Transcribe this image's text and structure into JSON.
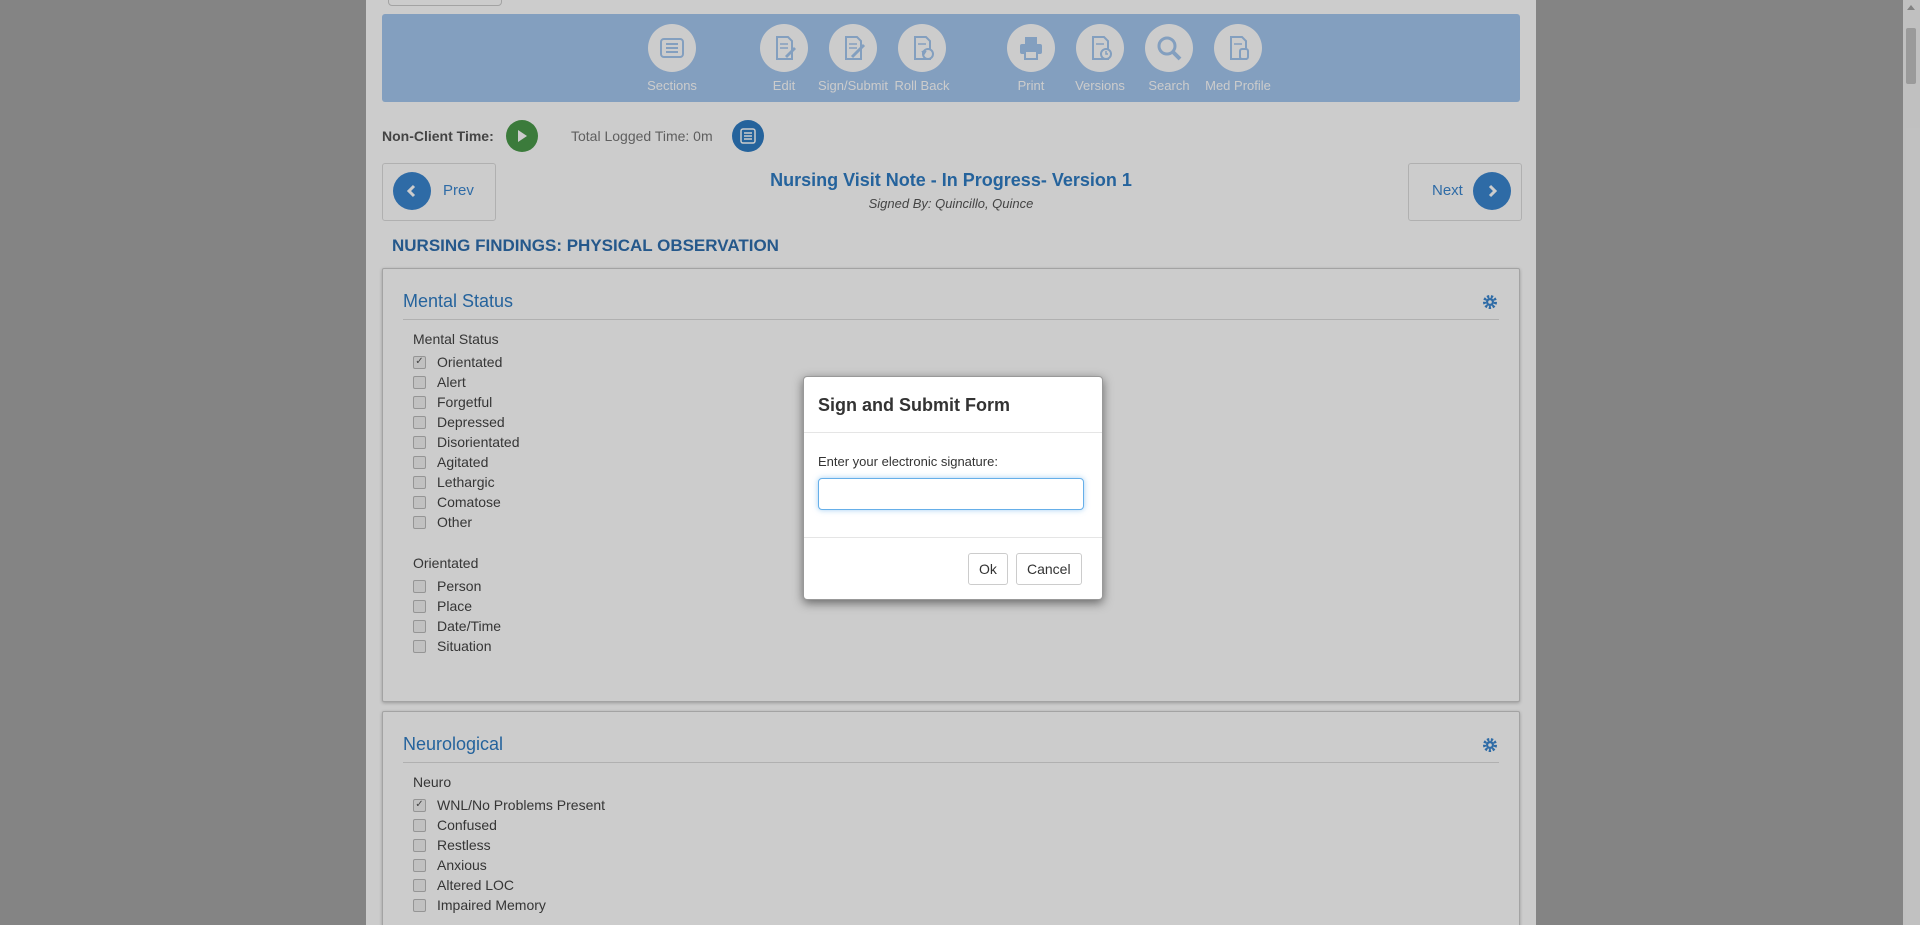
{
  "toolbar": {
    "buttons": [
      {
        "label": "Sections",
        "icon": "sections-icon"
      },
      {
        "label": "Edit",
        "icon": "edit-icon"
      },
      {
        "label": "Sign/Submit",
        "icon": "sign-icon"
      },
      {
        "label": "Roll Back",
        "icon": "rollback-icon"
      },
      {
        "label": "Print",
        "icon": "print-icon"
      },
      {
        "label": "Versions",
        "icon": "versions-icon"
      },
      {
        "label": "Search",
        "icon": "search-icon"
      },
      {
        "label": "Med Profile",
        "icon": "med-profile-icon"
      }
    ]
  },
  "time": {
    "label": "Non-Client Time:",
    "logged": "Total Logged Time: 0m"
  },
  "nav": {
    "prev": "Prev",
    "next": "Next"
  },
  "form": {
    "title": "Nursing Visit Note - In Progress- Version 1",
    "signed_by": "Signed By: Quincillo, Quince"
  },
  "section_heading": "NURSING FINDINGS: PHYSICAL OBSERVATION",
  "panels": [
    {
      "title": "Mental Status",
      "groups": [
        {
          "label": "Mental Status",
          "items": [
            {
              "label": "Orientated",
              "checked": true
            },
            {
              "label": "Alert",
              "checked": false
            },
            {
              "label": "Forgetful",
              "checked": false
            },
            {
              "label": "Depressed",
              "checked": false
            },
            {
              "label": "Disorientated",
              "checked": false
            },
            {
              "label": "Agitated",
              "checked": false
            },
            {
              "label": "Lethargic",
              "checked": false
            },
            {
              "label": "Comatose",
              "checked": false
            },
            {
              "label": "Other",
              "checked": false
            }
          ]
        },
        {
          "label": "Orientated",
          "items": [
            {
              "label": "Person",
              "checked": false
            },
            {
              "label": "Place",
              "checked": false
            },
            {
              "label": "Date/Time",
              "checked": false
            },
            {
              "label": "Situation",
              "checked": false
            }
          ]
        }
      ]
    },
    {
      "title": "Neurological",
      "groups": [
        {
          "label": "Neuro",
          "items": [
            {
              "label": "WNL/No Problems Present",
              "checked": true
            },
            {
              "label": "Confused",
              "checked": false
            },
            {
              "label": "Restless",
              "checked": false
            },
            {
              "label": "Anxious",
              "checked": false
            },
            {
              "label": "Altered LOC",
              "checked": false
            },
            {
              "label": "Impaired Memory",
              "checked": false
            }
          ]
        }
      ]
    }
  ],
  "modal": {
    "title": "Sign and Submit Form",
    "prompt": "Enter your electronic signature:",
    "input_value": "",
    "ok": "Ok",
    "cancel": "Cancel"
  },
  "colors": {
    "toolbar_bg": "#a4c7ef",
    "accent": "#2f7cc4",
    "play": "#4a9a4a",
    "overlay": "rgba(0,0,0,0.2)"
  }
}
